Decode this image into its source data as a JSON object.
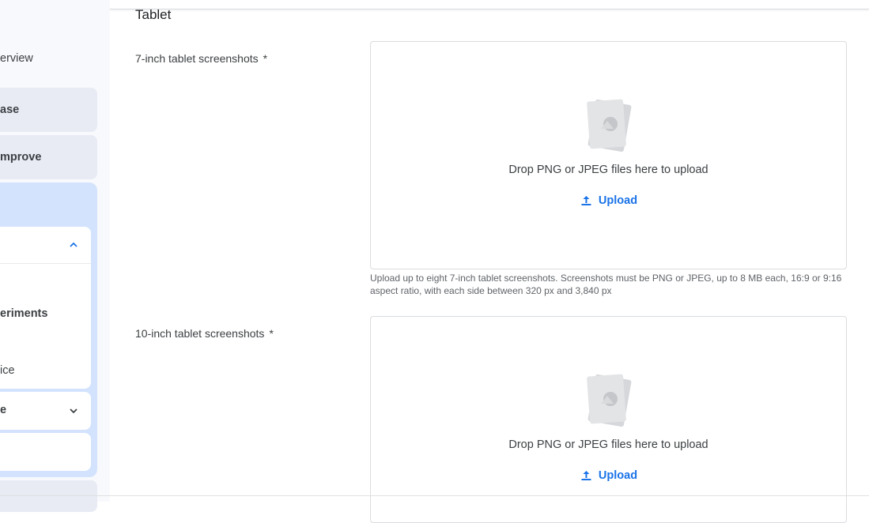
{
  "sidebar": {
    "overview_label": "erview",
    "release_label": "ase",
    "improve_label": "mprove",
    "experiments_label": "eriments",
    "advice_label": "ice",
    "collapsed_item_label": "e"
  },
  "section": {
    "title": "Tablet"
  },
  "fields": [
    {
      "label": "7-inch tablet screenshots",
      "required_mark": "*",
      "drop_text": "Drop PNG or JPEG files here to upload",
      "upload_label": "Upload",
      "helper": "Upload up to eight 7-inch tablet screenshots. Screenshots must be PNG or JPEG, up to 8 MB each, 16:9 or 9:16 aspect ratio, with each side between 320 px and 3,840 px"
    },
    {
      "label": "10-inch tablet screenshots",
      "required_mark": "*",
      "drop_text": "Drop PNG or JPEG files here to upload",
      "upload_label": "Upload"
    }
  ],
  "colors": {
    "accent": "#1a73e8",
    "sidebar_bg": "#f8f9fc",
    "selected_group": "#d3e3fd"
  },
  "icons": [
    "chevron-up-icon",
    "chevron-down-icon",
    "image-placeholder-icon",
    "upload-icon"
  ]
}
